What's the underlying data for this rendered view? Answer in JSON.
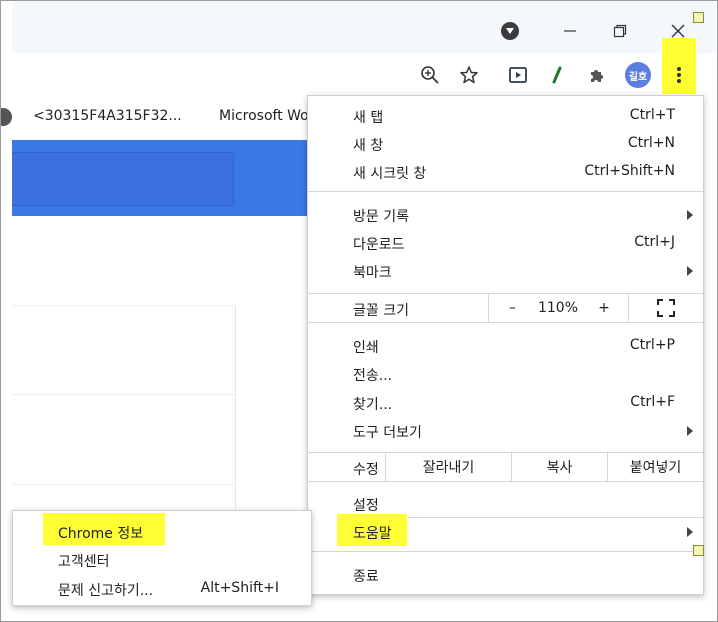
{
  "titlebar": {
    "minimize_icon": "minimize-icon",
    "restore_icon": "restore-icon",
    "close_icon": "close-icon",
    "tab_search_icon": "tab-search-dropdown-icon"
  },
  "toolbar": {
    "icons": [
      "zoom-icon",
      "star-icon",
      "media-icon",
      "extension-slash-icon",
      "puzzle-icon"
    ],
    "profile_label": "길호",
    "menu_icon": "three-dot-menu-icon",
    "highlight_color": "#ffff33"
  },
  "bookmarks": {
    "items": [
      "<30315F4A315F32...",
      "Microsoft Wo"
    ]
  },
  "menu": {
    "new_tab": {
      "label": "새 탭",
      "shortcut": "Ctrl+T"
    },
    "new_window": {
      "label": "새 창",
      "shortcut": "Ctrl+N"
    },
    "incognito": {
      "label": "새 시크릿 창",
      "shortcut": "Ctrl+Shift+N"
    },
    "history": {
      "label": "방문 기록"
    },
    "downloads": {
      "label": "다운로드",
      "shortcut": "Ctrl+J"
    },
    "bookmarks": {
      "label": "북마크"
    },
    "font_size": {
      "label": "글꼴 크기",
      "minus": "–",
      "value": "110%",
      "plus": "+"
    },
    "print": {
      "label": "인쇄",
      "shortcut": "Ctrl+P"
    },
    "cast": {
      "label": "전송..."
    },
    "find": {
      "label": "찾기...",
      "shortcut": "Ctrl+F"
    },
    "more_tools": {
      "label": "도구 더보기"
    },
    "edit": {
      "label": "수정",
      "cut": "잘라내기",
      "copy": "복사",
      "paste": "붙여넣기"
    },
    "settings": {
      "label": "설정"
    },
    "help": {
      "label": "도움말"
    },
    "exit": {
      "label": "종료"
    }
  },
  "help_submenu": {
    "about": {
      "label": "Chrome 정보"
    },
    "help_center": {
      "label": "고객센터"
    },
    "report": {
      "label": "문제 신고하기...",
      "shortcut": "Alt+Shift+I"
    }
  },
  "colors": {
    "accent_blue": "#3b78e7",
    "highlight": "#ffff33"
  }
}
